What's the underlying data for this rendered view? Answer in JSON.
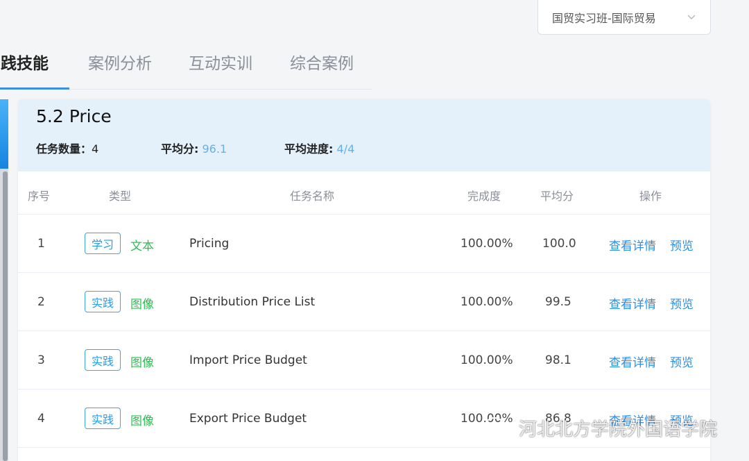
{
  "class_select": {
    "value": "国贸实习班-国际贸易",
    "icon": "chevron-down-icon"
  },
  "tabs": [
    {
      "label": "实践技能",
      "active": true
    },
    {
      "label": "案例分析",
      "active": false
    },
    {
      "label": "互动实训",
      "active": false
    },
    {
      "label": "综合案例",
      "active": false
    }
  ],
  "card": {
    "title": "5.2 Price",
    "task_count_label": "任务数量：",
    "task_count": "4",
    "avg_score_label": "平均分:",
    "avg_score": "96.1",
    "avg_progress_label": "平均进度:",
    "avg_progress": "4/4"
  },
  "table": {
    "headers": [
      "序号",
      "类型",
      "任务名称",
      "完成度",
      "平均分",
      "操作"
    ],
    "rows": [
      {
        "index": "1",
        "badge": "学习",
        "kind": "文本",
        "name": "Pricing",
        "completion": "100.00%",
        "score": "100.0",
        "detail": "查看详情",
        "preview": "预览"
      },
      {
        "index": "2",
        "badge": "实践",
        "kind": "图像",
        "name": "Distribution Price List",
        "completion": "100.00%",
        "score": "99.5",
        "detail": "查看详情",
        "preview": "预览"
      },
      {
        "index": "3",
        "badge": "实践",
        "kind": "图像",
        "name": "Import Price Budget",
        "completion": "100.00%",
        "score": "98.1",
        "detail": "查看详情",
        "preview": "预览"
      },
      {
        "index": "4",
        "badge": "实践",
        "kind": "图像",
        "name": "Export Price Budget",
        "completion": "100.00%",
        "score": "86.8",
        "detail": "查看详情",
        "preview": "预览"
      }
    ]
  },
  "watermark": {
    "text": "河北北方学院外国语学院",
    "icon": "wechat-logo-icon"
  },
  "colors": {
    "accent": "#2b8fe3",
    "header_bg": "#e4f1fb",
    "kind_green": "#2cbf4f",
    "stat_blue": "#63b0ea"
  }
}
